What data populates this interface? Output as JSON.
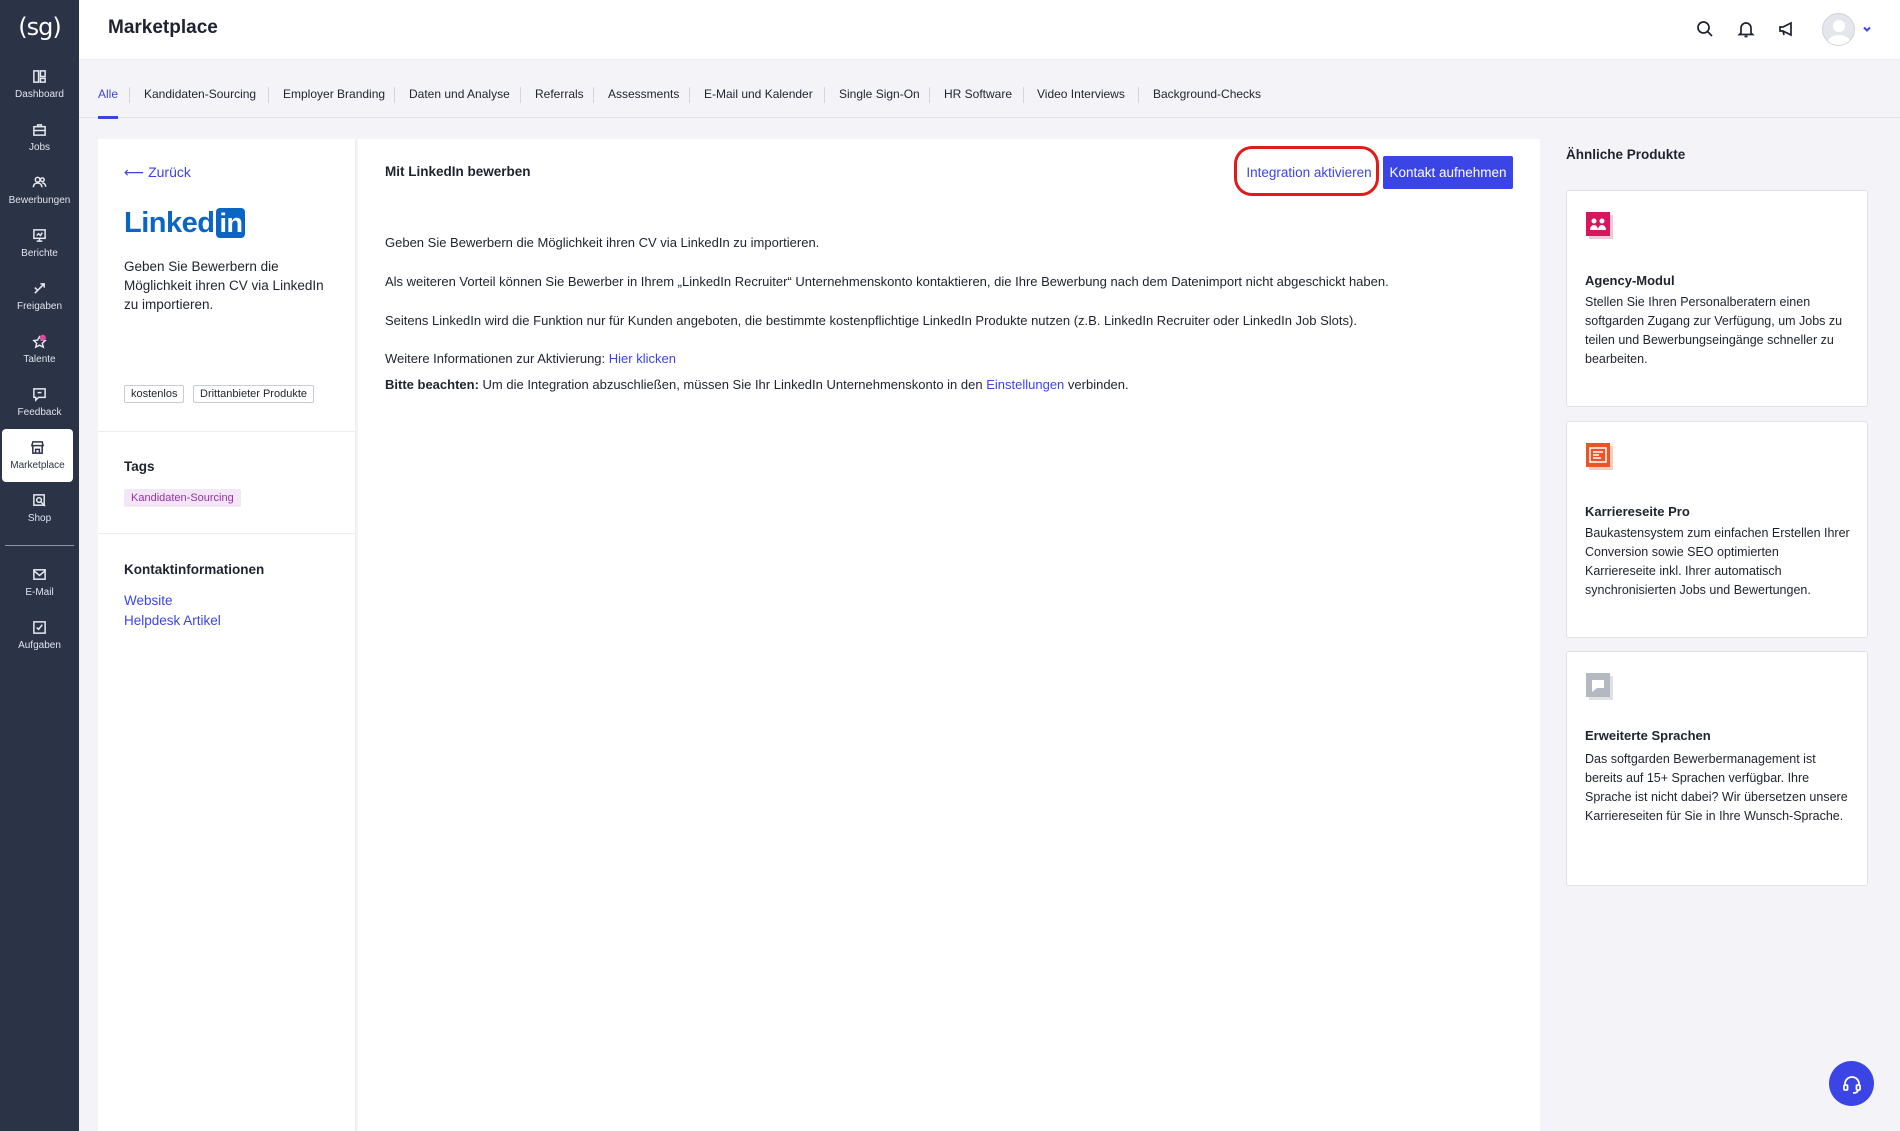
{
  "app": {
    "logo_text": "(sg)",
    "page_title": "Marketplace"
  },
  "sidebar": {
    "items": [
      {
        "label": "Dashboard",
        "icon": "dashboard-icon"
      },
      {
        "label": "Jobs",
        "icon": "briefcase-icon"
      },
      {
        "label": "Bewerbungen",
        "icon": "users-icon"
      },
      {
        "label": "Berichte",
        "icon": "chart-icon"
      },
      {
        "label": "Freigaben",
        "icon": "share-icon"
      },
      {
        "label": "Talente",
        "icon": "heart-icon"
      },
      {
        "label": "Feedback",
        "icon": "feedback-icon"
      },
      {
        "label": "Marketplace",
        "icon": "store-icon",
        "active": true
      },
      {
        "label": "Shop",
        "icon": "shop-icon"
      },
      {
        "label": "E-Mail",
        "icon": "mail-icon"
      },
      {
        "label": "Aufgaben",
        "icon": "task-icon"
      }
    ]
  },
  "header_icons": [
    "search-icon",
    "bell-icon",
    "megaphone-icon",
    "avatar",
    "chevron-down-icon"
  ],
  "tabs": [
    "Alle",
    "Kandidaten-Sourcing",
    "Employer Branding",
    "Daten und Analyse",
    "Referrals",
    "Assessments",
    "E-Mail und Kalender",
    "Single Sign-On",
    "HR Software",
    "Video Interviews",
    "Background-Checks"
  ],
  "detail": {
    "back_label": "Zurück",
    "logo_text": "Linked",
    "logo_in": "in",
    "short_desc": "Geben Sie Bewerbern die Möglichkeit ihren CV via LinkedIn zu importieren.",
    "badges": [
      "kostenlos",
      "Drittanbieter Produkte"
    ],
    "tags_heading": "Tags",
    "tag": "Kandidaten-Sourcing",
    "contact_heading": "Kontaktinformationen",
    "website_label": "Website",
    "helpdesk_label": "Helpdesk Artikel"
  },
  "main": {
    "title": "Mit LinkedIn bewerben",
    "activate_label": "Integration aktivieren",
    "contact_label": "Kontakt aufnehmen",
    "p1": "Geben Sie Bewerbern die Möglichkeit ihren CV via LinkedIn zu importieren.",
    "p2": "Als weiteren Vorteil können Sie Bewerber in Ihrem „LinkedIn Recruiter“ Unternehmenskonto kontaktieren, die Ihre Bewerbung nach dem Datenimport nicht abgeschickt haben.",
    "p3": "Seitens LinkedIn wird die Funktion nur für Kunden angeboten, die bestimmte kostenpflichtige LinkedIn Produkte nutzen (z.B. LinkedIn Recruiter oder LinkedIn Job Slots).",
    "p4_text": "Weitere Informationen zur Aktivierung:",
    "p4_link": "Hier klicken",
    "p5_bold": "Bitte beachten:",
    "p5_text": "Um die Integration abzuschließen, müssen Sie Ihr LinkedIn Unternehmenskonto in den",
    "p5_link": "Einstellungen",
    "p5_end": "verbinden."
  },
  "similar": {
    "heading": "Ähnliche Produkte",
    "cards": [
      {
        "title": "Agency-Modul",
        "desc": "Stellen Sie Ihren Personalberatern einen softgarden Zugang zur Verfügung, um Jobs zu teilen und Bewerbungseingänge schneller zu bearbeiten.",
        "color": "#d6175d"
      },
      {
        "title": "Karriereseite Pro",
        "desc": "Baukastensystem zum einfachen Erstellen Ihrer Conversion sowie SEO optimierten Karriereseite inkl. Ihrer automatisch synchronisierten Jobs und Bewertungen.",
        "color": "#e8552b"
      },
      {
        "title": "Erweiterte Sprachen",
        "desc": "Das softgarden Bewerbermanagement ist bereits auf 15+ Sprachen verfügbar. Ihre Sprache ist nicht dabei? Wir übersetzen unsere Karriereseiten für Sie in Ihre Wunsch-Sprache.",
        "color": "#9ea2ab"
      }
    ]
  },
  "colors": {
    "accent": "#3b45e6",
    "sidebar": "#2b3346",
    "highlight": "#e11b1b",
    "tag_bg": "#f3e6f7"
  }
}
